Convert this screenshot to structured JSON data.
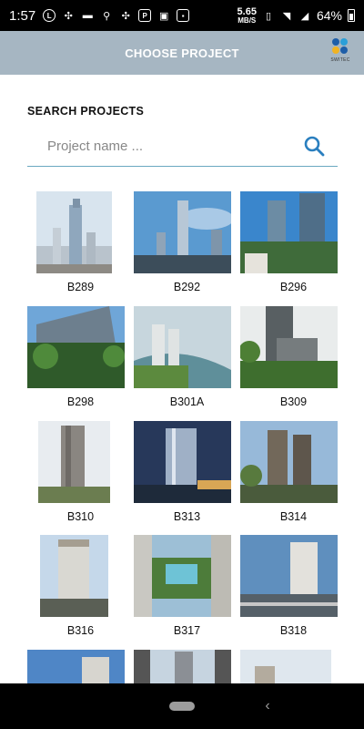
{
  "status_bar": {
    "time": "1:57",
    "net_speed_value": "5.65",
    "net_speed_unit": "MB/S",
    "battery": "64%"
  },
  "header": {
    "title": "CHOOSE PROJECT",
    "logo_text": "SWITEC",
    "colors": {
      "bar": "#a6b6c2"
    }
  },
  "search": {
    "label": "SEARCH PROJECTS",
    "placeholder": "Project name ..."
  },
  "projects": [
    {
      "code": "B289"
    },
    {
      "code": "B292"
    },
    {
      "code": "B296"
    },
    {
      "code": "B298"
    },
    {
      "code": "B301A"
    },
    {
      "code": "B309"
    },
    {
      "code": "B310"
    },
    {
      "code": "B313"
    },
    {
      "code": "B314"
    },
    {
      "code": "B316"
    },
    {
      "code": "B317"
    },
    {
      "code": "B318"
    }
  ],
  "accent_color": "#2a7fbf"
}
